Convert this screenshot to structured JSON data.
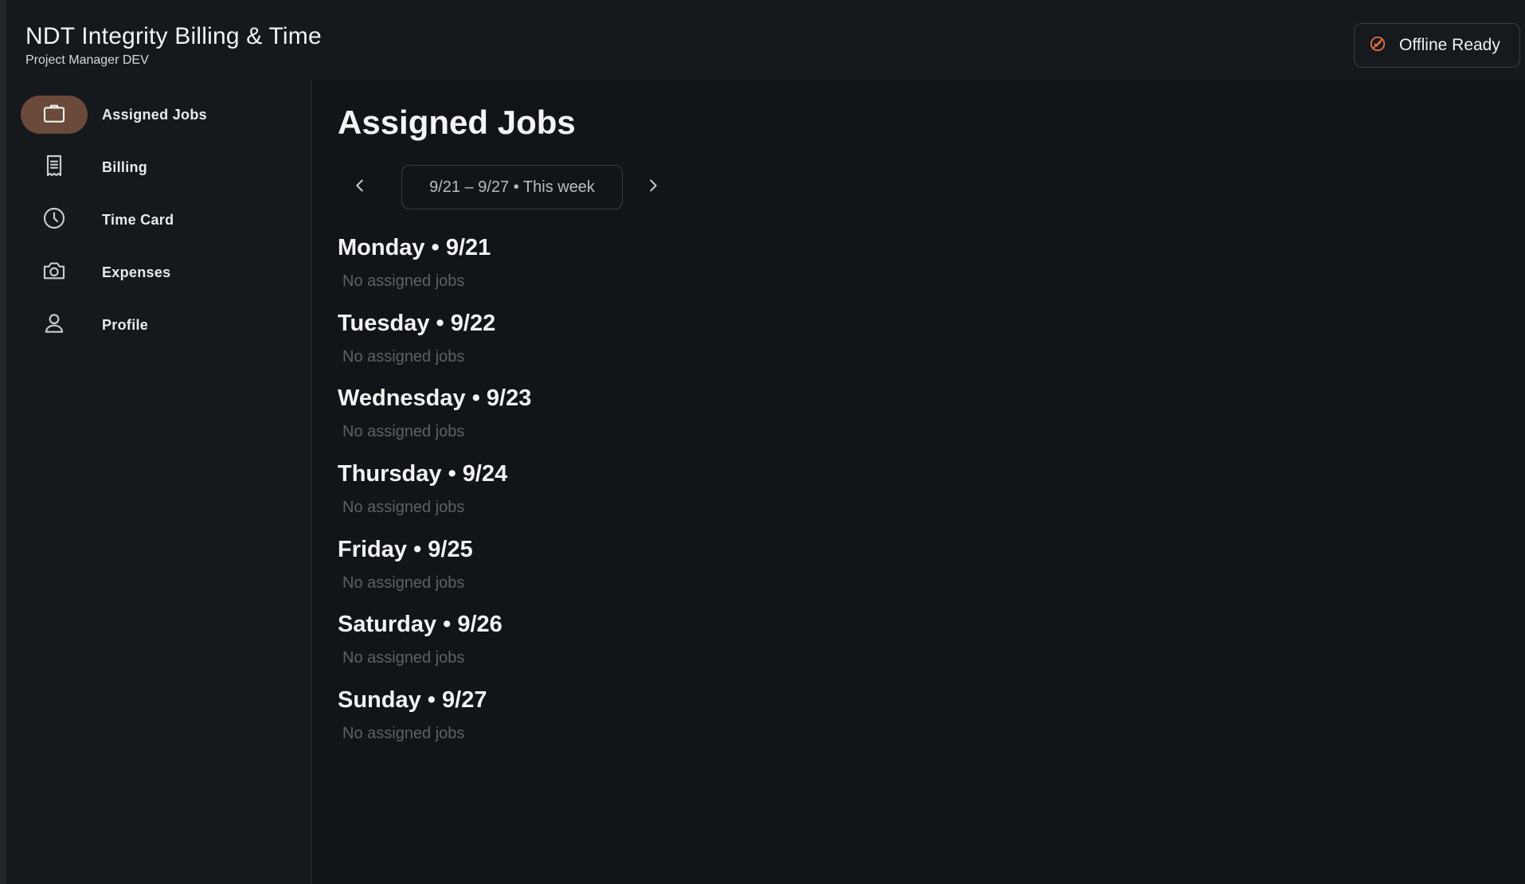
{
  "header": {
    "title": "NDT Integrity Billing & Time",
    "subtitle": "Project Manager DEV",
    "offline_label": "Offline Ready"
  },
  "sidebar": {
    "items": [
      {
        "label": "Assigned Jobs",
        "icon": "briefcase-icon",
        "active": true
      },
      {
        "label": "Billing",
        "icon": "receipt-icon",
        "active": false
      },
      {
        "label": "Time Card",
        "icon": "clock-icon",
        "active": false
      },
      {
        "label": "Expenses",
        "icon": "camera-icon",
        "active": false
      },
      {
        "label": "Profile",
        "icon": "person-icon",
        "active": false
      }
    ]
  },
  "main": {
    "title": "Assigned Jobs",
    "week_label": "9/21 – 9/27 • This week",
    "days": [
      {
        "heading": "Monday • 9/21",
        "empty": "No assigned jobs"
      },
      {
        "heading": "Tuesday • 9/22",
        "empty": "No assigned jobs"
      },
      {
        "heading": "Wednesday • 9/23",
        "empty": "No assigned jobs"
      },
      {
        "heading": "Thursday • 9/24",
        "empty": "No assigned jobs"
      },
      {
        "heading": "Friday • 9/25",
        "empty": "No assigned jobs"
      },
      {
        "heading": "Saturday • 9/26",
        "empty": "No assigned jobs"
      },
      {
        "heading": "Sunday • 9/27",
        "empty": "No assigned jobs"
      }
    ]
  },
  "colors": {
    "background": "#111418",
    "panel": "#15181d",
    "active_pill": "#6b4a3a",
    "offline_accent": "#e0703a",
    "muted_text": "#5d6168"
  }
}
